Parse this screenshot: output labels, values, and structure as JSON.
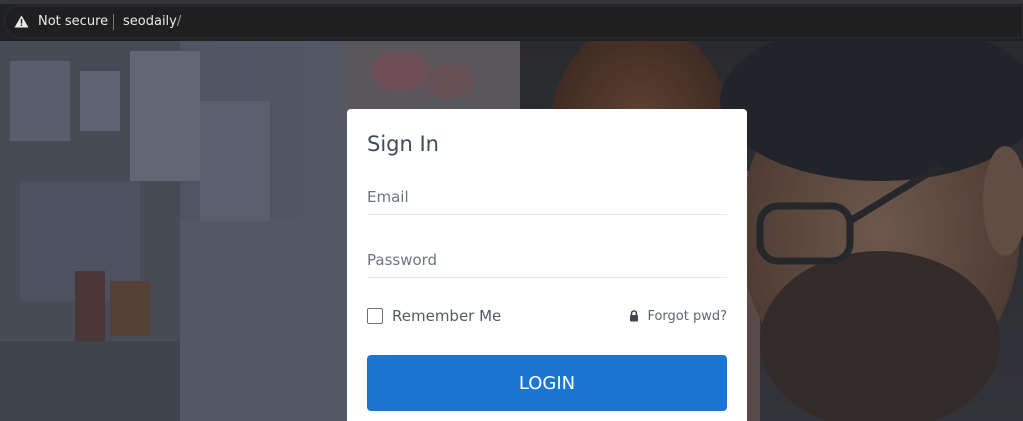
{
  "browser": {
    "security_label": "Not secure",
    "url_host": "seodaily",
    "url_path": "/",
    "security_icon": "warning-triangle-icon"
  },
  "login_form": {
    "title": "Sign In",
    "email_placeholder": "Email",
    "email_value": "",
    "password_placeholder": "Password",
    "password_value": "",
    "remember_label": "Remember Me",
    "remember_checked": false,
    "forgot_label": "Forgot pwd?",
    "forgot_icon": "lock-icon",
    "login_label": "LOGIN"
  },
  "colors": {
    "login_button": "#1a76d2",
    "card_background": "#ffffff",
    "browser_bar": "#202124"
  }
}
